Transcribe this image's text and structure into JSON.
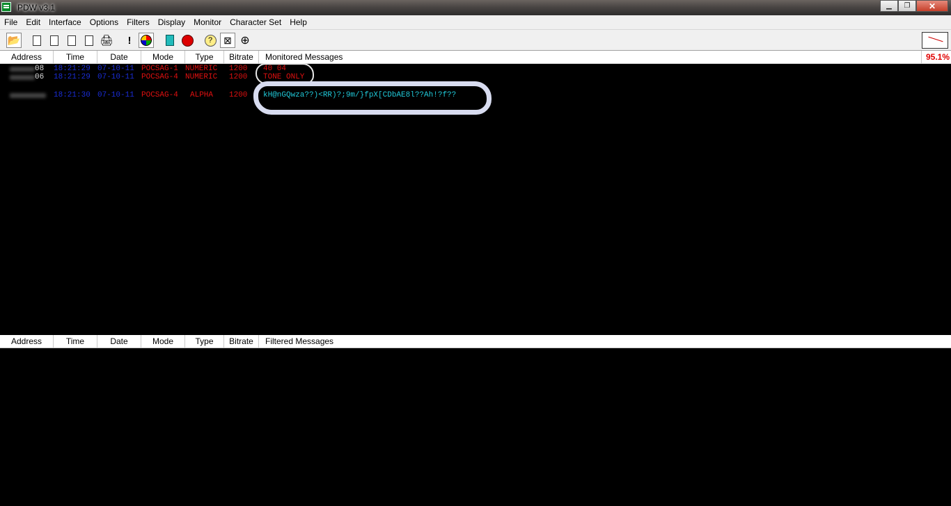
{
  "window": {
    "title": "PDW v3.1"
  },
  "menu": [
    "File",
    "Edit",
    "Interface",
    "Options",
    "Filters",
    "Display",
    "Monitor",
    "Character Set",
    "Help"
  ],
  "columns": {
    "address": "Address",
    "time": "Time",
    "date": "Date",
    "mode": "Mode",
    "type": "Type",
    "bitrate": "Bitrate"
  },
  "monitored": {
    "header": "Monitored Messages",
    "signal_percent": "95.1%",
    "rows": [
      {
        "address_suffix": "08",
        "time": "18:21:29",
        "date": "07-10-11",
        "mode": "POCSAG-1",
        "type": "NUMERIC",
        "bitrate": "1200",
        "message": "40 04"
      },
      {
        "address_suffix": "06",
        "time": "18:21:29",
        "date": "07-10-11",
        "mode": "POCSAG-4",
        "type": "NUMERIC",
        "bitrate": "1200",
        "message": "TONE ONLY"
      },
      {
        "address_suffix": "",
        "time": "18:21:30",
        "date": "07-10-11",
        "mode": "POCSAG-4",
        "type": "ALPHA",
        "bitrate": "1200",
        "message": "kH@nGQwza??)<RR)?;9m/}fpX[CDbAE8l??Ah!?f??"
      }
    ]
  },
  "filtered": {
    "header": "Filtered Messages"
  },
  "colors": {
    "time": "#1a2dd6",
    "mode": "#e01010",
    "message_numeric": "#e01010",
    "message_alpha": "#20c8d8",
    "signal": "#e00000"
  }
}
